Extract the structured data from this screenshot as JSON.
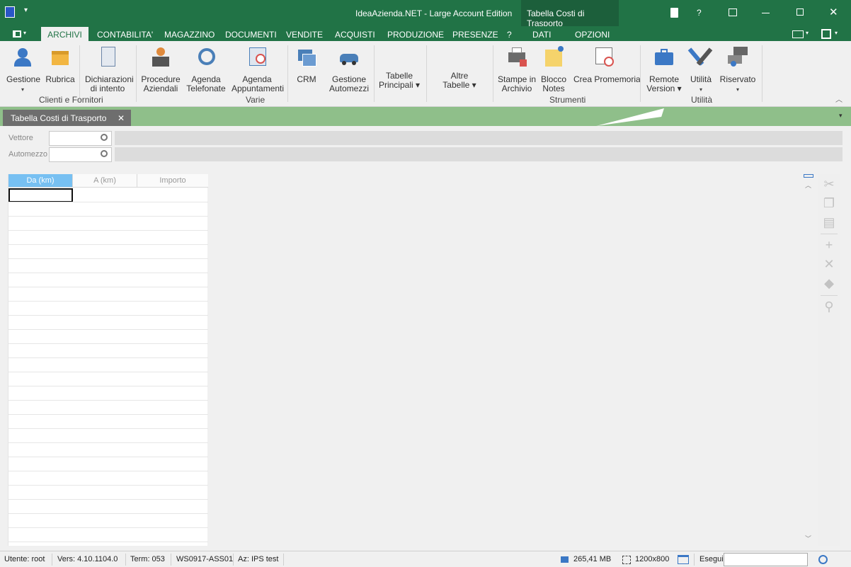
{
  "window": {
    "title": "IdeaAzienda.NET - Large Account Edition",
    "context_title": "Tabella Costi di Trasporto",
    "help": "?"
  },
  "ribbon_tabs": [
    "ARCHIVI",
    "CONTABILITA'",
    "MAGAZZINO",
    "DOCUMENTI",
    "VENDITE",
    "ACQUISTI",
    "PRODUZIONE",
    "PRESENZE",
    "?",
    "DATI",
    "OPZIONI"
  ],
  "ribbon": {
    "buttons": [
      {
        "label1": "Gestione",
        "label2": "",
        "drop": true
      },
      {
        "label1": "Rubrica",
        "label2": "",
        "drop": false
      },
      {
        "label1": "Dichiarazioni",
        "label2": "di intento",
        "drop": false
      },
      {
        "label1": "Procedure",
        "label2": "Aziendali",
        "drop": false
      },
      {
        "label1": "Agenda",
        "label2": "Telefonate",
        "drop": false
      },
      {
        "label1": "Agenda",
        "label2": "Appuntamenti",
        "drop": false
      },
      {
        "label1": "CRM",
        "label2": "",
        "drop": false
      },
      {
        "label1": "Gestione",
        "label2": "Automezzi",
        "drop": false
      },
      {
        "label1": "Tabelle",
        "label2": "Principali ▾",
        "drop": false
      },
      {
        "label1": "Altre",
        "label2": "Tabelle ▾",
        "drop": false
      },
      {
        "label1": "Stampe in",
        "label2": "Archivio",
        "drop": false
      },
      {
        "label1": "Blocco",
        "label2": "Notes",
        "drop": false
      },
      {
        "label1": "Crea Promemoria",
        "label2": "",
        "drop": false
      },
      {
        "label1": "Remote",
        "label2": "Version ▾",
        "drop": false
      },
      {
        "label1": "Utilità",
        "label2": "",
        "drop": true
      },
      {
        "label1": "Riservato",
        "label2": "",
        "drop": true
      }
    ],
    "groups": [
      "Clienti e Fornitori",
      "Varie",
      "Strumenti",
      "Utilità"
    ]
  },
  "document_tab": {
    "label": "Tabella Costi di Trasporto",
    "close": "✕"
  },
  "filters": {
    "vettore_label": "Vettore",
    "automezzo_label": "Automezzo"
  },
  "grid": {
    "columns": [
      "Da (km)",
      "A (km)",
      "Importo"
    ]
  },
  "status": {
    "utente": "Utente: root",
    "versione": "Vers: 4.10.1104.0",
    "term": "Term: 053",
    "ws": "WS0917-ASS01",
    "azienda": "Az: IPS test",
    "memory": "265,41 MB",
    "resolution": "1200x800",
    "esegui": "Esegui"
  },
  "colors": {
    "accent": "#217346",
    "docbar": "#8fbf8a",
    "context": "#1c5f3b"
  }
}
